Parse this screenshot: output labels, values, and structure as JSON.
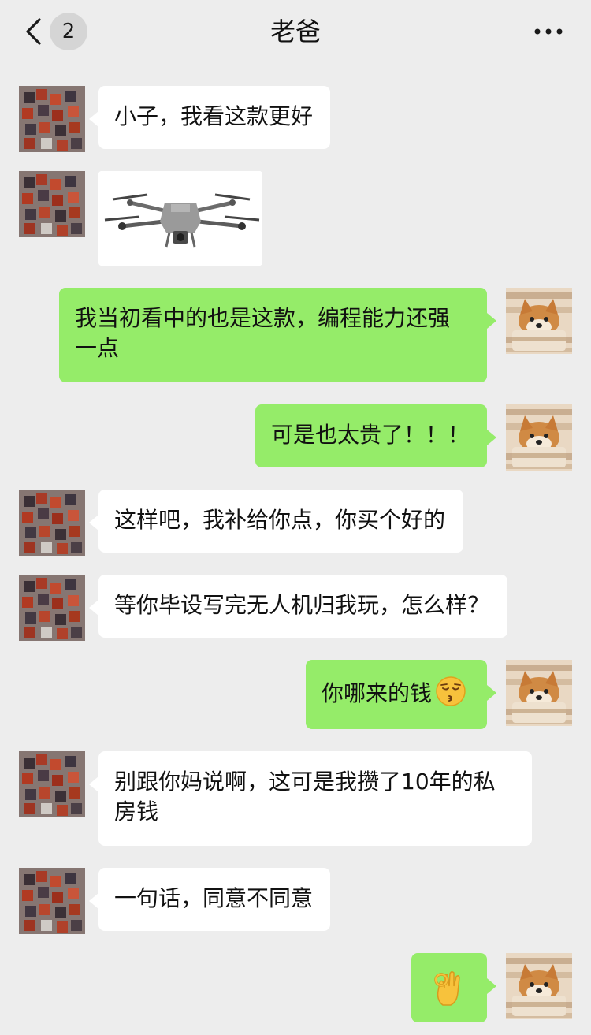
{
  "header": {
    "back_icon": "chevron-left-icon",
    "unread_count": "2",
    "title": "老爸",
    "more_icon": "more-dots-icon"
  },
  "colors": {
    "background": "#ededed",
    "bubble_self": "#95ec69",
    "bubble_other": "#ffffff"
  },
  "messages": [
    {
      "from": "dad",
      "type": "text",
      "text": "小子，我看这款更好"
    },
    {
      "from": "dad",
      "type": "image",
      "image": "drone-photo"
    },
    {
      "from": "me",
      "type": "text",
      "text": "我当初看中的也是这款，编程能力还强一点"
    },
    {
      "from": "me",
      "type": "text",
      "text": "可是也太贵了！！！"
    },
    {
      "from": "dad",
      "type": "text",
      "text": "这样吧，我补给你点，你买个好的"
    },
    {
      "from": "dad",
      "type": "text",
      "text": "等你毕设写完无人机归我玩，怎么样？"
    },
    {
      "from": "me",
      "type": "text",
      "text": "你哪来的钱",
      "emoji": "kissing-face-emoji"
    },
    {
      "from": "dad",
      "type": "text",
      "text": "别跟你妈说啊，这可是我攒了10年的私房钱"
    },
    {
      "from": "dad",
      "type": "text",
      "text": "一句话，同意不同意"
    },
    {
      "from": "me",
      "type": "emoji",
      "emoji": "ok-hand-emoji"
    }
  ]
}
